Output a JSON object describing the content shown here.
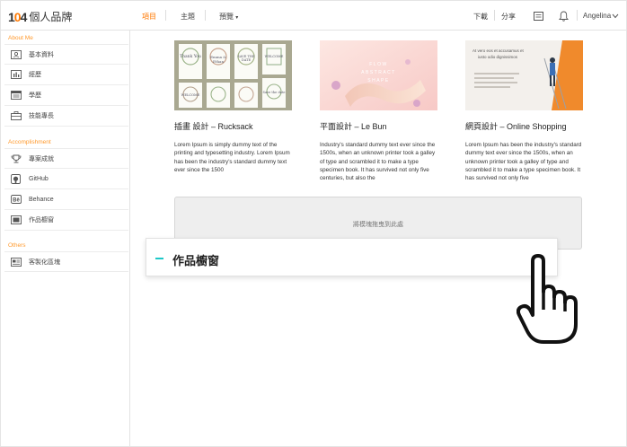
{
  "header": {
    "logo_num_prefix": "1",
    "logo_num_suffix": "4",
    "logo_name": "個人品牌",
    "nav": [
      "項目",
      "主題",
      "預覽"
    ],
    "nav_active_index": 0,
    "preview_caret": "▾",
    "download": "下載",
    "share": "分享",
    "user": "Angelina",
    "accent_color": "#ff7800"
  },
  "sidebar": {
    "sections": [
      {
        "title": "About Me",
        "items": [
          {
            "label": "基本資料",
            "icon": "id-card-icon"
          },
          {
            "label": "經歷",
            "icon": "chart-icon"
          },
          {
            "label": "學歷",
            "icon": "document-icon"
          },
          {
            "label": "技能專長",
            "icon": "briefcase-icon"
          }
        ]
      },
      {
        "title": "Accomplishment",
        "items": [
          {
            "label": "專案成就",
            "icon": "trophy-icon"
          },
          {
            "label": "GitHub",
            "icon": "github-icon"
          },
          {
            "label": "Behance",
            "icon": "behance-icon"
          },
          {
            "label": "作品櫥窗",
            "icon": "image-icon"
          }
        ]
      },
      {
        "title": "Others",
        "items": [
          {
            "label": "客製化區塊",
            "icon": "custom-block-icon"
          }
        ]
      }
    ]
  },
  "cards": [
    {
      "title": "插畫 設計 – Rucksack",
      "desc": "Lorem Ipsum is simply dummy text of the printing and typesetting industry. Lorem Ipsum has been the industry's standard dummy text ever since the 1500",
      "thumb_words": [
        "Thank You",
        "Emma & Ethan",
        "SAVE THE DATE",
        "WELCOME",
        "WELCOME",
        "Save the date"
      ]
    },
    {
      "title": "平面設計 – Le Bun",
      "desc": "Industry's standard dummy text ever since the 1500s, when an unknown printer took a galley of type and scrambled it to make a type specimen book. It has survived not only five centuries, but also the",
      "thumb_words": [
        "FLOW",
        "ABSTRACT",
        "SHAPE"
      ]
    },
    {
      "title": "網頁設計 – Online Shopping",
      "desc": "Lorem Ipsum has been the industry's standard dummy text ever since the 1500s, when an unknown printer took a galley of type and scrambled it to make a type specimen book. It has survived not only five",
      "thumb_words": [
        "At vero eos et accusamus et",
        "iusto odio dignissimos"
      ]
    }
  ],
  "dropzone_text": "將模塊拖曳到此處",
  "dragging_block": "作品櫥窗"
}
